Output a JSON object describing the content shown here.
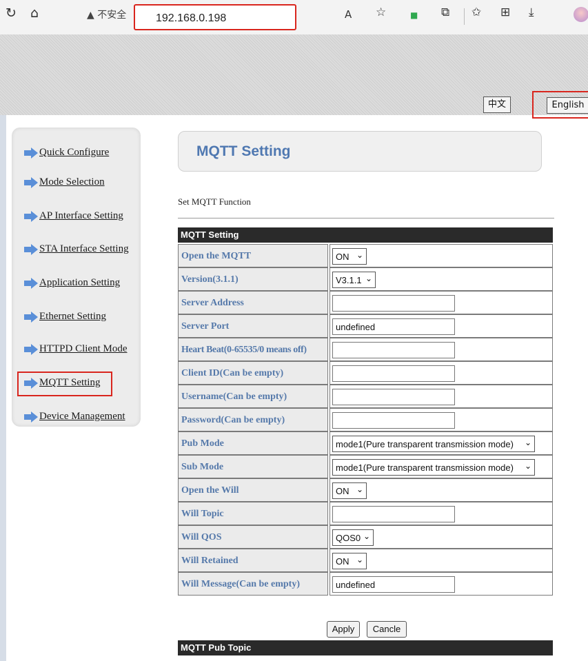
{
  "browser": {
    "security_label": "不安全",
    "url": "192.168.0.198"
  },
  "header": {
    "lang_cn": "中文",
    "lang_en": "English"
  },
  "sidebar": {
    "items": [
      {
        "label": "Quick Configure"
      },
      {
        "label": "Mode Selection"
      },
      {
        "label": "AP Interface Setting"
      },
      {
        "label": "STA Interface Setting"
      },
      {
        "label": "Application Setting"
      },
      {
        "label": "Ethernet Setting"
      },
      {
        "label": "HTTPD Client Mode"
      },
      {
        "label": "MQTT Setting"
      },
      {
        "label": "Device Management"
      }
    ],
    "active": "MQTT Setting"
  },
  "main": {
    "title": "MQTT Setting",
    "subtitle": "Set MQTT Function",
    "section_header": "MQTT Setting",
    "rows": [
      {
        "label": "Open the MQTT",
        "type": "select",
        "value": "ON"
      },
      {
        "label": "Version(3.1.1)",
        "type": "select",
        "value": "V3.1.1"
      },
      {
        "label": "Server Address",
        "type": "input",
        "value": ""
      },
      {
        "label": "Server Port",
        "type": "input",
        "value": "undefined"
      },
      {
        "label": "Heart Beat(0-65535/0 means off)",
        "type": "input",
        "value": ""
      },
      {
        "label": "Client ID(Can be empty)",
        "type": "input",
        "value": ""
      },
      {
        "label": "Username(Can be empty)",
        "type": "input",
        "value": ""
      },
      {
        "label": "Password(Can be empty)",
        "type": "input",
        "value": ""
      },
      {
        "label": "Pub Mode",
        "type": "select",
        "value": "mode1(Pure transparent transmission mode)"
      },
      {
        "label": "Sub Mode",
        "type": "select",
        "value": "mode1(Pure transparent transmission mode)"
      },
      {
        "label": "Open the Will",
        "type": "select",
        "value": "ON"
      },
      {
        "label": "Will Topic",
        "type": "input",
        "value": ""
      },
      {
        "label": "Will QOS",
        "type": "select",
        "value": "QOS0"
      },
      {
        "label": "Will Retained",
        "type": "select",
        "value": "ON"
      },
      {
        "label": "Will Message(Can be empty)",
        "type": "input",
        "value": "undefined"
      }
    ],
    "apply_label": "Apply",
    "cancel_label": "Cancle",
    "pub_topic_header": "MQTT Pub Topic"
  },
  "colors": {
    "accent": "#4f78b1",
    "label_text": "#5579aa",
    "highlight": "#d9251d",
    "table_header": "#2a2a2a"
  }
}
